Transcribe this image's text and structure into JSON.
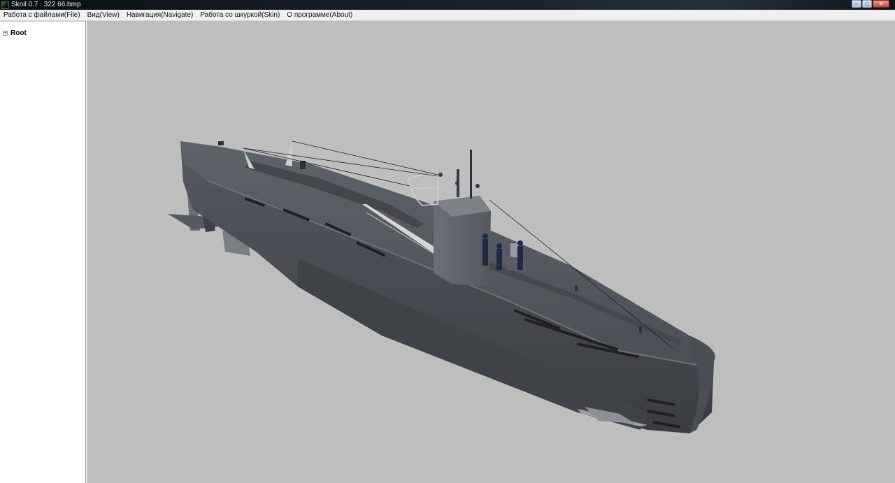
{
  "window": {
    "title": "Sknil 0.7   322 66.bmp",
    "controls": {
      "minimize": "–",
      "maximize": "□",
      "close": "✕"
    }
  },
  "menu": {
    "items": [
      {
        "label": "Работа с файлами(File)"
      },
      {
        "label": "Вид(View)"
      },
      {
        "label": "Навигация(Navigate)"
      },
      {
        "label": "Работа со шкуркой(Skin)"
      },
      {
        "label": "О программе(About)"
      }
    ]
  },
  "tree": {
    "root": {
      "label": "Root",
      "expander": "+"
    }
  },
  "viewport": {
    "background": "#bebebe",
    "model": "submarine-3d-model"
  }
}
